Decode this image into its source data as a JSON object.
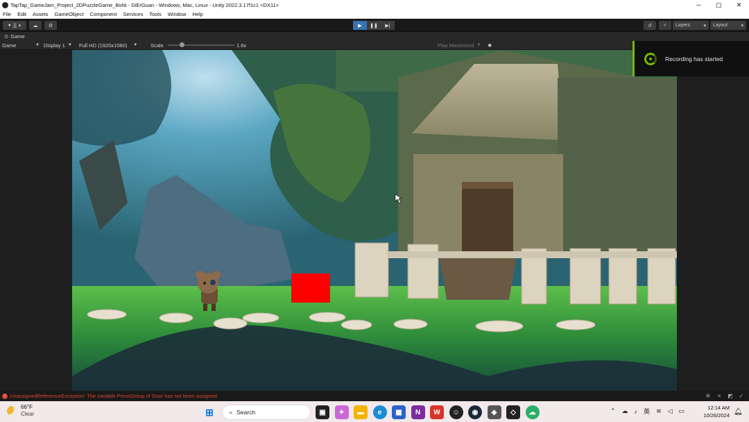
{
  "window": {
    "title": "TapTap_GameJam_Project_2DPuzzleGame_BoNi - DiErGuan - Windows, Mac, Linux - Unity 2022.3.17f1c1 <DX11>",
    "minimize": "─",
    "maximize": "▢",
    "close": "✕"
  },
  "menu": [
    "File",
    "Edit",
    "Assets",
    "GameObject",
    "Component",
    "Services",
    "Tools",
    "Window",
    "Help"
  ],
  "toolbar": {
    "account_label": "主",
    "play_icon": "▶",
    "pause_icon": "❚❚",
    "step_icon": "▶|",
    "layers_label": "Layers",
    "layout_label": "Layout"
  },
  "game_tab": {
    "label": "Game"
  },
  "game_bar": {
    "view": "Game",
    "display": "Display 1",
    "resolution": "Full HD (1920x1080)",
    "scale_label": "Scale",
    "scale_value": "1.6x",
    "scale_fraction": 0.19,
    "play_mode": "Play Maximized"
  },
  "toast": {
    "message": "Recording has started",
    "accent": "#76b900"
  },
  "status": {
    "error": "UnassignedReferenceException: The variable PressGroup of Door has not been assigned.",
    "error_color": "#d54430"
  },
  "taskbar": {
    "weather_temp": "66°F",
    "weather_cond": "Clear",
    "search_placeholder": "Search",
    "time": "12:14 AM",
    "date": "10/26/2024",
    "ime": "英"
  }
}
